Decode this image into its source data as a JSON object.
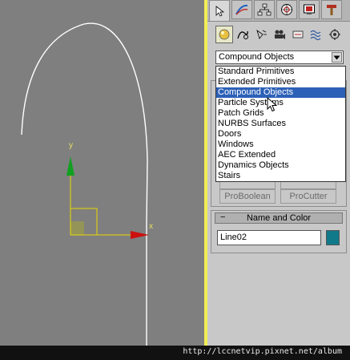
{
  "viewport": {
    "axis_x_label": "x",
    "axis_y_label": "y"
  },
  "command_panel": {
    "tabs": [
      {
        "name": "create",
        "icon": "cursor-arrow-icon"
      },
      {
        "name": "modify",
        "icon": "modify-curve-icon"
      },
      {
        "name": "hierarchy",
        "icon": "hierarchy-icon"
      },
      {
        "name": "motion",
        "icon": "motion-icon"
      },
      {
        "name": "display",
        "icon": "display-icon"
      },
      {
        "name": "utilities",
        "icon": "hammer-icon"
      }
    ],
    "category_icons": [
      "geometry-icon",
      "shapes-icon",
      "lights-icon",
      "cameras-icon",
      "helpers-icon",
      "space-warps-icon",
      "systems-icon"
    ],
    "object_type_dropdown": {
      "selected": "Compound Objects",
      "options": [
        "Standard Primitives",
        "Extended Primitives",
        "Compound Objects",
        "Particle Systems",
        "Patch Grids",
        "NURBS Surfaces",
        "Doors",
        "Windows",
        "AEC Extended",
        "Dynamics Objects",
        "Stairs"
      ]
    },
    "object_buttons": [
      {
        "label": "ProBoolean"
      },
      {
        "label": "ProCutter"
      }
    ],
    "name_and_color": {
      "title": "Name and Color",
      "collapse_symbol": "−",
      "name_value": "Line02",
      "color": "#117a8a"
    }
  },
  "watermark": {
    "text": "http://lccnetvip.pixnet.net/album"
  },
  "colors": {
    "viewport_bg": "#7f7f7f",
    "active_viewport_border": "#f2ee55",
    "dropdown_highlight": "#2d61b8",
    "axis_x": "#cc1010",
    "axis_y": "#10a020"
  }
}
